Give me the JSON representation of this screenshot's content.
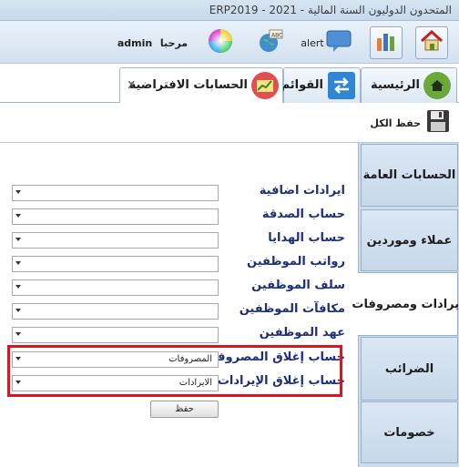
{
  "window": {
    "title": "ERP2019 - المتحدون الدوليون  السنة المالية - 2021"
  },
  "toolbar": {
    "greeting": "مرحبا",
    "user": "admin",
    "alert_label": "alert",
    "home_icon": "home-icon",
    "reports_icon": "bar-chart-icon",
    "alert_icon": "speech-bubble-icon",
    "spellcheck_icon": "globe-abc-icon",
    "theme_icon": "color-wheel-icon"
  },
  "tabs": [
    {
      "label": "الرئيسية",
      "icon": "home-icon"
    },
    {
      "label": "القوائم",
      "icon": "swap-arrows-icon"
    },
    {
      "label": "الحسابات الافتراضية",
      "icon": "chart-icon",
      "active": true,
      "close": "x"
    }
  ],
  "actions": {
    "save_all": "حفظ الكل"
  },
  "form": {
    "rows": [
      {
        "label": "ايرادات اضافية",
        "value": ""
      },
      {
        "label": "حساب الصدقة",
        "value": ""
      },
      {
        "label": "حساب الهدايا",
        "value": ""
      },
      {
        "label": "رواتب الموظفين",
        "value": ""
      },
      {
        "label": "سلف الموظفين",
        "value": ""
      },
      {
        "label": "مكافآت الموظفين",
        "value": ""
      },
      {
        "label": "عهد الموظفين",
        "value": ""
      },
      {
        "label": "حساب إغلاق المصروفات",
        "value": "المصروفات"
      },
      {
        "label": "حساب إغلاق الإيرادات",
        "value": "الايرادات"
      }
    ],
    "save_button": "حفظ"
  },
  "sidenav": {
    "items": [
      {
        "label": "الحسابات العامة"
      },
      {
        "label": "عملاء وموردين"
      },
      {
        "label": "ايرادات ومصروفات",
        "active": true
      },
      {
        "label": "الضرائب"
      },
      {
        "label": "خصومات"
      }
    ]
  },
  "colors": {
    "highlight": "#e0141e",
    "label_text": "#1b2f7a",
    "nav_bg": "#cfdceb"
  }
}
